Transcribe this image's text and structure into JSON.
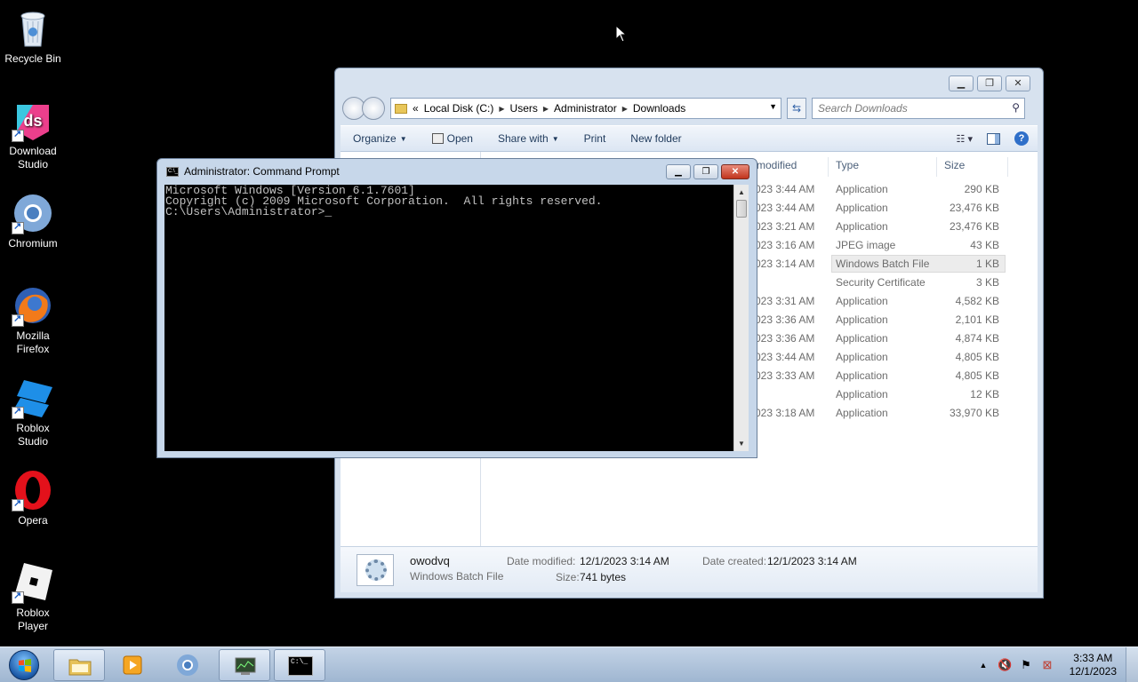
{
  "desktop": {
    "icons": [
      {
        "label": "Recycle Bin"
      },
      {
        "label": "Download Studio"
      },
      {
        "label": "Chromium"
      },
      {
        "label": "Mozilla Firefox"
      },
      {
        "label": "Roblox Studio"
      },
      {
        "label": "Opera"
      },
      {
        "label": "Roblox Player"
      }
    ]
  },
  "explorer": {
    "address": {
      "overflow": "«",
      "crumbs": [
        "Local Disk (C:)",
        "Users",
        "Administrator",
        "Downloads"
      ]
    },
    "search_placeholder": "Search Downloads",
    "toolbar": {
      "organize": "Organize",
      "open": "Open",
      "share_with": "Share with",
      "print": "Print",
      "new_folder": "New folder"
    },
    "columns": {
      "date_modified": "modified",
      "type": "Type",
      "size": "Size"
    },
    "files": [
      {
        "date": "023 3:44 AM",
        "type": "Application",
        "size": "290 KB"
      },
      {
        "date": "023 3:44 AM",
        "type": "Application",
        "size": "23,476 KB"
      },
      {
        "date": "023 3:21 AM",
        "type": "Application",
        "size": "23,476 KB"
      },
      {
        "date": "023 3:16 AM",
        "type": "JPEG image",
        "size": "43 KB"
      },
      {
        "date": "023 3:14 AM",
        "type": "Windows Batch File",
        "size": "1 KB"
      },
      {
        "date": "",
        "type": "Security Certificate",
        "size": "3 KB"
      },
      {
        "date": "023 3:31 AM",
        "type": "Application",
        "size": "4,582 KB"
      },
      {
        "date": "023 3:36 AM",
        "type": "Application",
        "size": "2,101 KB"
      },
      {
        "date": "023 3:36 AM",
        "type": "Application",
        "size": "4,874 KB"
      },
      {
        "date": "023 3:44 AM",
        "type": "Application",
        "size": "4,805 KB"
      },
      {
        "date": "023 3:33 AM",
        "type": "Application",
        "size": "4,805 KB"
      },
      {
        "date": "",
        "type": "Application",
        "size": "12 KB"
      },
      {
        "date": "023 3:18 AM",
        "type": "Application",
        "size": "33,970 KB"
      }
    ],
    "details": {
      "name": "owodvq",
      "type": "Windows Batch File",
      "date_modified_label": "Date modified:",
      "date_modified": "12/1/2023 3:14 AM",
      "date_created_label": "Date created:",
      "date_created": "12/1/2023 3:14 AM",
      "size_label": "Size:",
      "size": "741 bytes"
    }
  },
  "cmd": {
    "title": "Administrator:  Command Prompt",
    "icon_text": "C:\\_",
    "lines": [
      "Microsoft Windows [Version 6.1.7601]",
      "Copyright (c) 2009 Microsoft Corporation.  All rights reserved.",
      "",
      "C:\\Users\\Administrator>_"
    ]
  },
  "taskbar": {
    "time": "3:33 AM",
    "date": "12/1/2023",
    "cmd_icon_text": "C:\\_"
  },
  "colors": {
    "desktop_bg": "#000000",
    "taskbar": "#b3c6dc",
    "close_red": "#c1341c"
  }
}
